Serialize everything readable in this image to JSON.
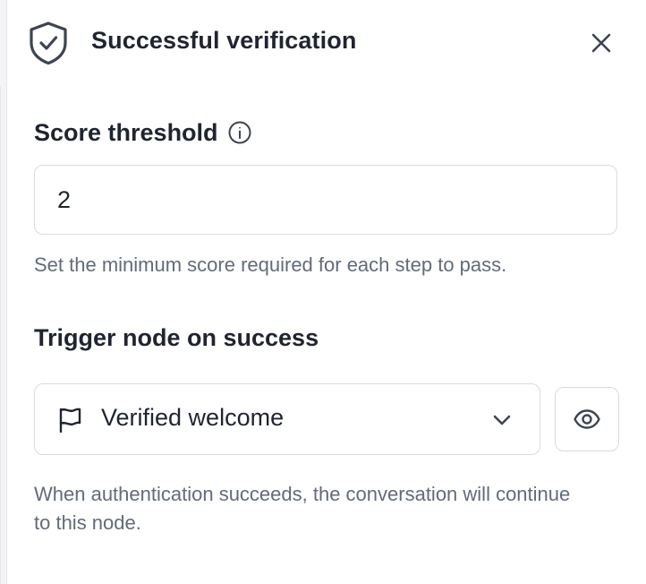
{
  "header": {
    "title": "Successful verification",
    "icon": "shield-check-icon",
    "close_icon": "close-icon"
  },
  "score_threshold": {
    "label": "Score threshold",
    "info_icon": "info-icon",
    "value": "2",
    "help": "Set the minimum score required for each step to pass."
  },
  "trigger": {
    "label": "Trigger node on success",
    "selected_icon": "flag-icon",
    "selected_value": "Verified welcome",
    "dropdown_icon": "chevron-down-icon",
    "preview_icon": "eye-icon",
    "help": "When authentication succeeds, the conversation will continue to this node."
  },
  "colors": {
    "text": "#1f2430",
    "muted_text": "#626b7a",
    "border": "#d8dbe1",
    "icon": "#3d4452"
  }
}
